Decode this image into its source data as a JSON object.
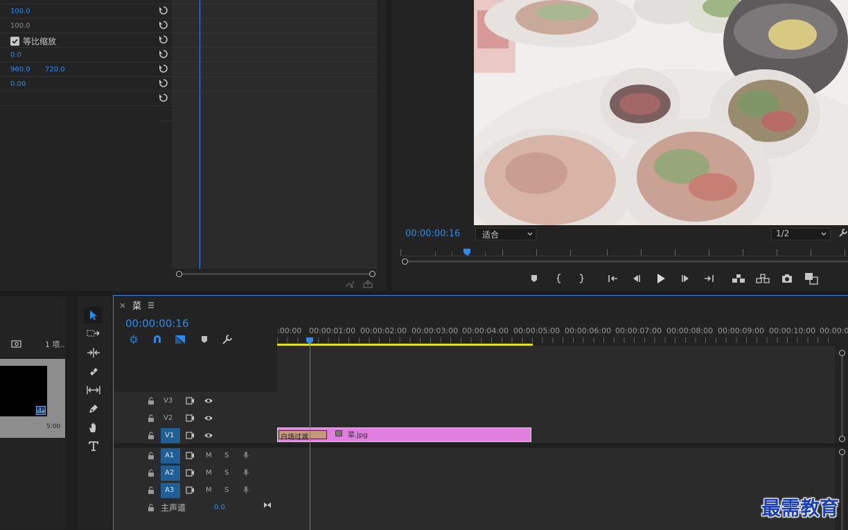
{
  "effects": {
    "rows": [
      {
        "v1": "100.0",
        "v2": ""
      },
      {
        "v1": "100.0",
        "v2": ""
      },
      {
        "v1": "",
        "v2": ""
      },
      {
        "v1": "0.0",
        "v2": ""
      },
      {
        "v1": "960.0",
        "v2": "720.0"
      },
      {
        "v1": "0.00",
        "v2": ""
      },
      {
        "v1": "",
        "v2": ""
      }
    ],
    "uniform_scale_label": "等比缩放"
  },
  "program": {
    "timecode": "00:00:00:16",
    "zoom_value": "适合",
    "resolution_value": "1/2"
  },
  "project": {
    "item_count": "1 项...",
    "thumb_duration": "5:00"
  },
  "timeline": {
    "tab_title": "菜",
    "timecode": "00:00:00:16",
    "ruler": [
      ":00:00",
      "00:00:01:00",
      "00:00:02:00",
      "00:00:03:00",
      "00:00:04:00",
      "00:00:05:00",
      "00:00:06:00",
      "00:00:07:00",
      "00:00:08:00",
      "00:00:09:00",
      "00:00:10:00",
      "00:00:0"
    ],
    "video_tracks": [
      "V3",
      "V2",
      "V1"
    ],
    "audio_tracks": [
      "A1",
      "A2",
      "A3"
    ],
    "mute_label": "M",
    "solo_label": "S",
    "master_label": "主声道",
    "master_value": "0.0",
    "transition_label": "白场过渡",
    "clip_label": "菜.jpg"
  },
  "watermark": "最需教育",
  "colors": {
    "accent_blue": "#2d8ceb",
    "clip_pink": "#e07fe0",
    "transition_tan": "#c49a7f",
    "work_area_yellow": "#e6e21c",
    "track_target_blue": "#1f5f95"
  }
}
